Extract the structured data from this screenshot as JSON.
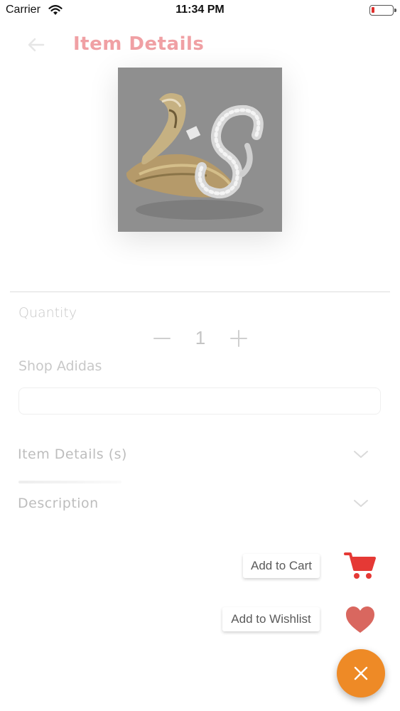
{
  "status_bar": {
    "carrier": "Carrier",
    "time": "11:34 PM",
    "wifi_icon": "wifi-icon",
    "battery_icon": "battery-low-icon",
    "battery_color": "#e0302c"
  },
  "header": {
    "title": "Item Details",
    "back_icon": "arrow-left-icon",
    "title_color": "#f0a0a4"
  },
  "product": {
    "image_icon": "ring-product-image"
  },
  "quantity": {
    "label": "Quantity",
    "value": "1",
    "minus_icon": "minus-icon",
    "plus_icon": "plus-icon"
  },
  "shop": {
    "label": "Shop Adidas",
    "input_value": ""
  },
  "sections": {
    "details_title": "Item Details (s)",
    "description_title": "Description",
    "chevron_icon": "chevron-down-icon"
  },
  "actions": {
    "cart_label": "Add to Cart",
    "wishlist_label": "Add to Wishlist",
    "cart_icon": "shopping-cart-icon",
    "wishlist_icon": "heart-icon",
    "cart_color": "#e53935",
    "heart_color": "#d9675f",
    "fab_icon": "close-icon",
    "fab_color": "#ee8a26"
  }
}
